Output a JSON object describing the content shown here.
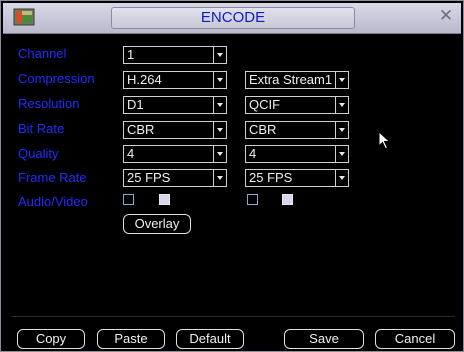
{
  "window": {
    "title": "ENCODE",
    "icons": {
      "app": "app-icon",
      "close": "close-icon"
    }
  },
  "labels": {
    "channel": "Channel",
    "compression": "Compression",
    "resolution": "Resolution",
    "bit_rate": "Bit Rate",
    "quality": "Quality",
    "frame_rate": "Frame Rate",
    "audio_video": "Audio/Video"
  },
  "main_stream": {
    "channel": "1",
    "compression": "H.264",
    "resolution": "D1",
    "bit_rate": "CBR",
    "quality": "4",
    "frame_rate": "25 FPS",
    "audio_checked": false,
    "video_checked": true
  },
  "extra_stream": {
    "stream": "Extra Stream1",
    "resolution": "QCIF",
    "bit_rate": "CBR",
    "quality": "4",
    "frame_rate": "25 FPS",
    "audio_checked": false,
    "video_checked": true
  },
  "buttons": {
    "overlay": "Overlay",
    "copy": "Copy",
    "paste": "Paste",
    "default": "Default",
    "save": "Save",
    "cancel": "Cancel"
  },
  "colors": {
    "label": "#1f2cff",
    "title": "#0b1cc7",
    "background": "#000000",
    "value_text": "#f0f0f0"
  }
}
